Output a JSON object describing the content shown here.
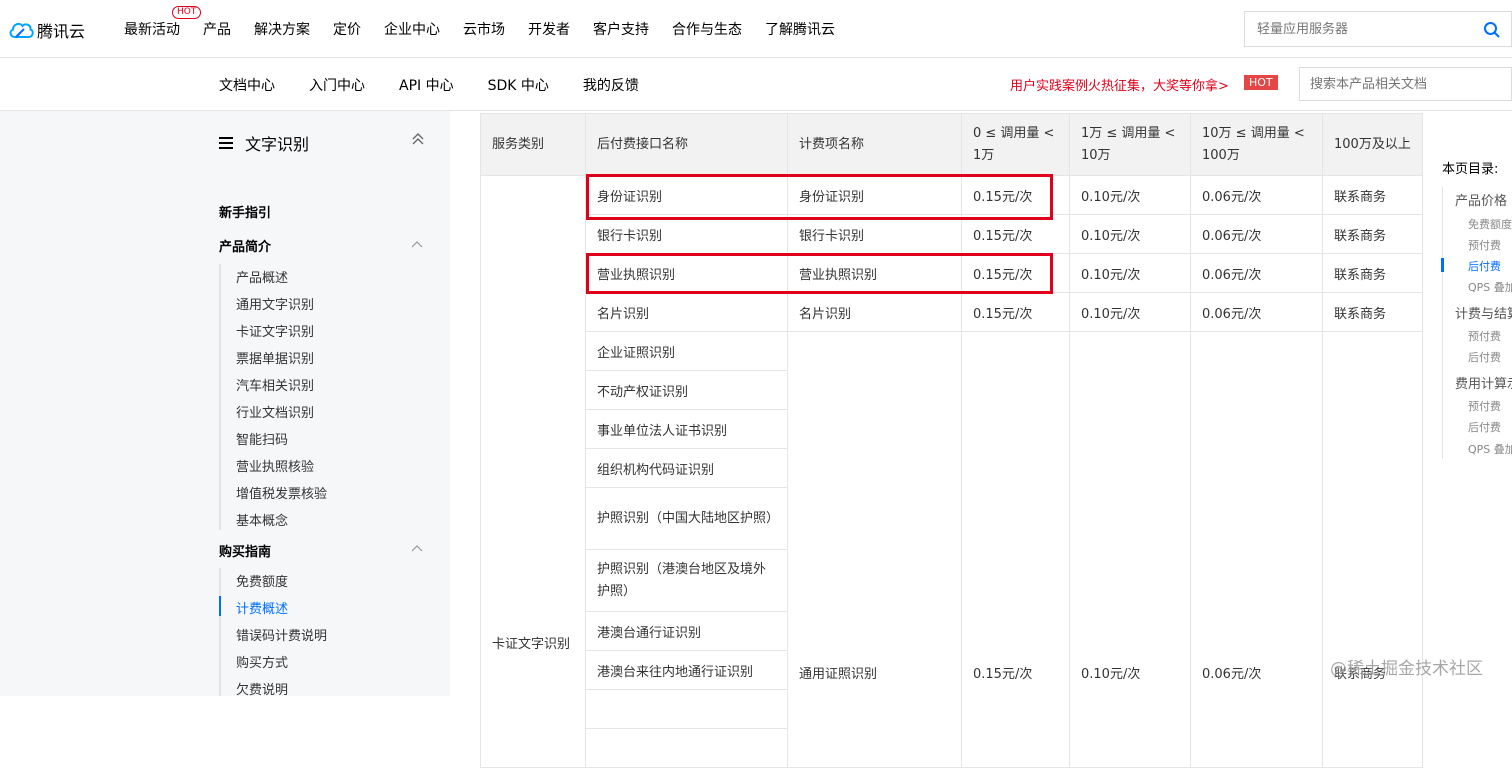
{
  "topbar": {
    "brand": "腾讯云",
    "nav": [
      "最新活动",
      "产品",
      "解决方案",
      "定价",
      "企业中心",
      "云市场",
      "开发者",
      "客户支持",
      "合作与生态",
      "了解腾讯云"
    ],
    "hot_badge": "HOT",
    "search_placeholder": "轻量应用服务器"
  },
  "subbar": {
    "nav": [
      "文档中心",
      "入门中心",
      "API 中心",
      "SDK 中心",
      "我的反馈"
    ],
    "promo": "用户实践案例火热征集，大奖等你拿>",
    "promo_badge": "HOT",
    "search_placeholder": "搜索本产品相关文档"
  },
  "sidebar": {
    "title": "文字识别",
    "sections": [
      {
        "label": "新手指引",
        "items": []
      },
      {
        "label": "产品简介",
        "items": [
          "产品概述",
          "通用文字识别",
          "卡证文字识别",
          "票据单据识别",
          "汽车相关识别",
          "行业文档识别",
          "智能扫码",
          "营业执照核验",
          "增值税发票核验",
          "基本概念"
        ]
      },
      {
        "label": "购买指南",
        "items": [
          "免费额度",
          "计费概述",
          "错误码计费说明",
          "购买方式",
          "欠费说明"
        ]
      }
    ],
    "active_item": "计费概述"
  },
  "table": {
    "headers": [
      "服务类别",
      "后付费接口名称",
      "计费项名称",
      "0 ≤ 调用量 < 1万",
      "1万 ≤ 调用量 < 10万",
      "10万 ≤ 调用量 < 100万",
      "100万及以上"
    ],
    "rows": [
      {
        "api": "身份证识别",
        "item": "身份证识别",
        "p1": "0.15元/次",
        "p2": "0.10元/次",
        "p3": "0.06元/次",
        "p4": "联系商务"
      },
      {
        "api": "银行卡识别",
        "item": "银行卡识别",
        "p1": "0.15元/次",
        "p2": "0.10元/次",
        "p3": "0.06元/次",
        "p4": "联系商务"
      },
      {
        "api": "营业执照识别",
        "item": "营业执照识别",
        "p1": "0.15元/次",
        "p2": "0.10元/次",
        "p3": "0.06元/次",
        "p4": "联系商务"
      },
      {
        "api": "名片识别",
        "item": "名片识别",
        "p1": "0.15元/次",
        "p2": "0.10元/次",
        "p3": "0.06元/次",
        "p4": "联系商务"
      }
    ],
    "category": "卡证文字识别",
    "group_apis": [
      "企业证照识别",
      "不动产权证识别",
      "事业单位法人证书识别",
      "组织机构代码证识别",
      "护照识别（中国大陆地区护照）",
      "护照识别（港澳台地区及境外护照）",
      "港澳台通行证识别",
      "港澳台来往内地通行证识别"
    ],
    "group": {
      "item": "通用证照识别",
      "p1": "0.15元/次",
      "p2": "0.10元/次",
      "p3": "0.06元/次",
      "p4": "联系商务"
    }
  },
  "toc": {
    "title": "本页目录:",
    "items": [
      {
        "label": "产品价格",
        "level": 1
      },
      {
        "label": "免费额度",
        "level": 2
      },
      {
        "label": "预付费",
        "level": 2
      },
      {
        "label": "后付费",
        "level": 2,
        "active": true
      },
      {
        "label": "QPS 叠加",
        "level": 2
      },
      {
        "label": "计费与结算",
        "level": 1
      },
      {
        "label": "预付费",
        "level": 2
      },
      {
        "label": "后付费",
        "level": 2
      },
      {
        "label": "费用计算示例",
        "level": 1
      },
      {
        "label": "预付费",
        "level": 2
      },
      {
        "label": "后付费",
        "level": 2
      },
      {
        "label": "QPS 叠加",
        "level": 2
      }
    ]
  },
  "watermark": "@稀土掘金技术社区",
  "colors": {
    "accent": "#006eff",
    "highlight": "#e0001b"
  }
}
